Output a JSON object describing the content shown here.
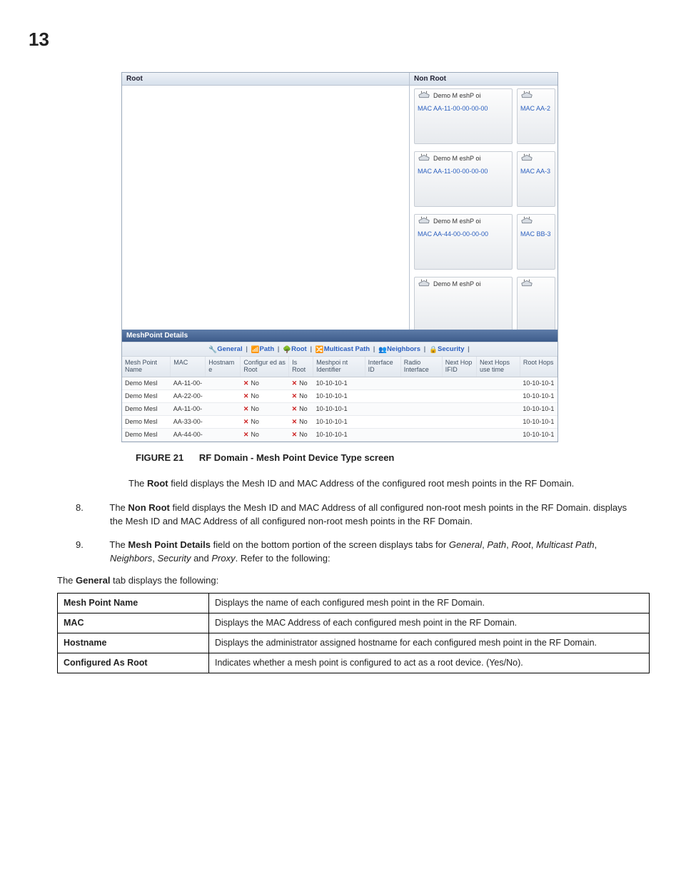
{
  "page_number": "13",
  "panes": {
    "root_title": "Root",
    "nonroot_title": "Non Root",
    "devices": [
      {
        "name": "Demo M eshP oi",
        "mac": "MAC AA-11-00-00-00-00",
        "mac2": "MAC AA-2"
      },
      {
        "name": "Demo M eshP oi",
        "mac": "MAC AA-11-00-00-00-00",
        "mac2": "MAC AA-3"
      },
      {
        "name": "Demo M eshP oi",
        "mac": "MAC AA-44-00-00-00-00",
        "mac2": "MAC BB-3"
      },
      {
        "name": "Demo M eshP oi",
        "mac": "",
        "mac2": ""
      }
    ]
  },
  "details": {
    "header": "MeshPoint Details",
    "tabs": {
      "general": "General",
      "path": "Path",
      "root": "Root",
      "multicast": "Multicast Path",
      "neighbors": "Neighbors",
      "security": "Security"
    },
    "columns": {
      "c0": "Mesh Point Name",
      "c1": "MAC",
      "c2": "Hostnam e",
      "c3": "Configur ed as Root",
      "c4": "Is Root",
      "c5": "Meshpoi nt Identifier",
      "c6": "Interface ID",
      "c7": "Radio Interface",
      "c8": "Next Hop IFID",
      "c9": "Next Hops use time",
      "c10": "Root Hops"
    },
    "rows": [
      {
        "name": "Demo Mesl",
        "mac": "AA-11-00-",
        "cfg": "No",
        "isroot": "No",
        "mpid": "10-10-10-1",
        "rhops": "10-10-10-1"
      },
      {
        "name": "Demo Mesl",
        "mac": "AA-22-00-",
        "cfg": "No",
        "isroot": "No",
        "mpid": "10-10-10-1",
        "rhops": "10-10-10-1"
      },
      {
        "name": "Demo Mesl",
        "mac": "AA-11-00-",
        "cfg": "No",
        "isroot": "No",
        "mpid": "10-10-10-1",
        "rhops": "10-10-10-1"
      },
      {
        "name": "Demo Mesl",
        "mac": "AA-33-00-",
        "cfg": "No",
        "isroot": "No",
        "mpid": "10-10-10-1",
        "rhops": "10-10-10-1"
      },
      {
        "name": "Demo Mesl",
        "mac": "AA-44-00-",
        "cfg": "No",
        "isroot": "No",
        "mpid": "10-10-10-1",
        "rhops": "10-10-10-1"
      }
    ]
  },
  "caption": {
    "label": "FIGURE 21",
    "text": "RF Domain - Mesh Point Device Type screen"
  },
  "body": {
    "p1a": "The ",
    "p1b": "Root",
    "p1c": " field displays the Mesh ID and MAC Address of the configured root mesh points in the RF Domain.",
    "i8n": "8.",
    "i8a": "The ",
    "i8b": "Non Root",
    "i8c": " field displays the Mesh ID and MAC Address of all configured non-root mesh points in the RF Domain. displays the Mesh ID and MAC Address of all configured non-root mesh points in the RF Domain.",
    "i9n": "9.",
    "i9a": "The ",
    "i9b": "Mesh Point Details",
    "i9c": " field on the bottom portion of the screen displays tabs for ",
    "i9d": "General",
    "i9e": ", ",
    "i9f": "Path",
    "i9g": ", ",
    "i9h": "Root",
    "i9i": ", ",
    "i9j": "Multicast Path",
    "i9k": ", ",
    "i9l": "Neighbors",
    "i9m": ", ",
    "i9n2": "Security",
    "i9o": " and ",
    "i9p": "Proxy",
    "i9q": ". Refer to the following:",
    "g1a": "The ",
    "g1b": "General",
    "g1c": " tab displays the following:"
  },
  "desc_rows": [
    {
      "k": "Mesh Point Name",
      "v": "Displays the name of each configured mesh point in the RF Domain."
    },
    {
      "k": "MAC",
      "v": "Displays the MAC Address of each configured mesh point in the RF Domain."
    },
    {
      "k": "Hostname",
      "v": "Displays the administrator assigned hostname for each configured mesh point in the RF Domain."
    },
    {
      "k": "Configured As Root",
      "v": "Indicates whether a mesh point is configured to act as a root device. (Yes/No)."
    }
  ]
}
